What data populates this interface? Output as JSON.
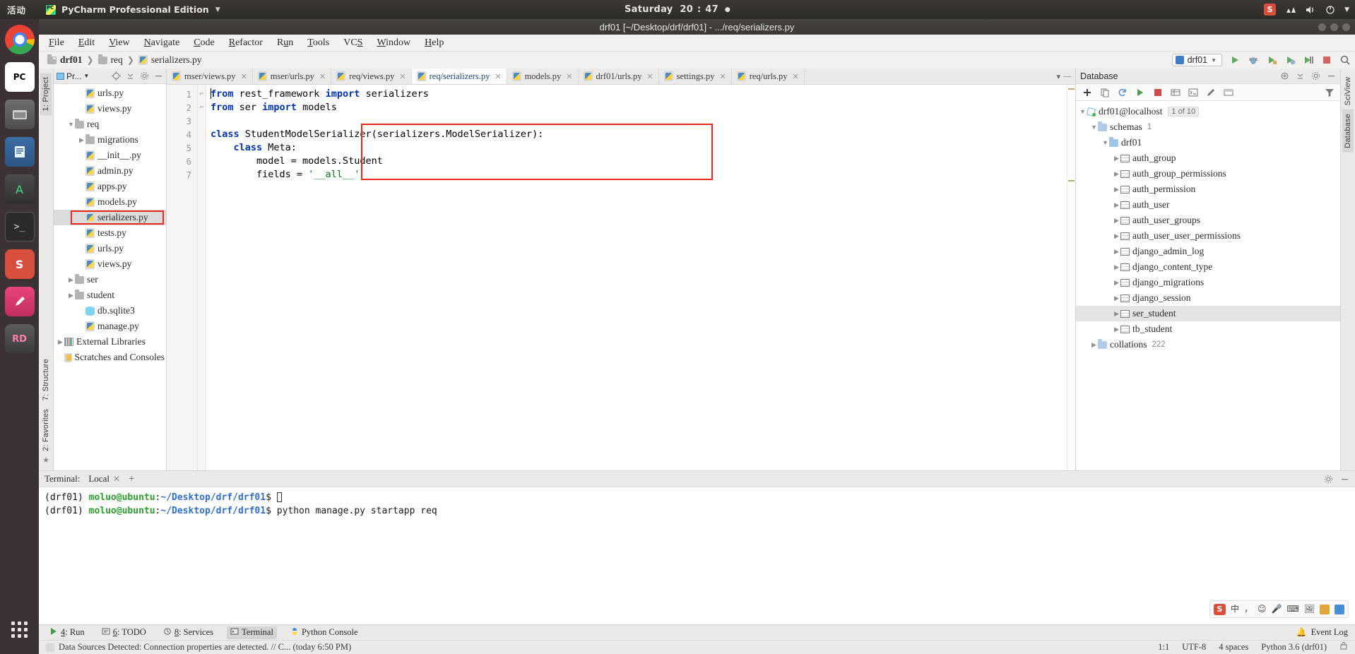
{
  "desktop": {
    "activities": "活动",
    "app_name": "PyCharm Professional Edition",
    "clock_day": "Saturday",
    "clock_hour": "20",
    "clock_sep": ":",
    "clock_min": "47",
    "tray": [
      "sogou-input-icon",
      "network-icon",
      "volume-icon",
      "power-icon",
      "caret-down-icon"
    ],
    "launcher": [
      {
        "name": "chrome",
        "label": ""
      },
      {
        "name": "pycharm",
        "label": "PC"
      },
      {
        "name": "files",
        "label": ""
      },
      {
        "name": "libreoffice",
        "label": ""
      },
      {
        "name": "android-studio",
        "label": "A"
      },
      {
        "name": "terminal",
        "label": ">_"
      },
      {
        "name": "sogou",
        "label": "S"
      },
      {
        "name": "pen-tool",
        "label": ""
      },
      {
        "name": "rd-tool",
        "label": "RD"
      }
    ]
  },
  "window": {
    "title": "drf01 [~/Desktop/drf/drf01] - .../req/serializers.py"
  },
  "menu": [
    {
      "pre": "",
      "mn": "F",
      "post": "ile"
    },
    {
      "pre": "",
      "mn": "E",
      "post": "dit"
    },
    {
      "pre": "",
      "mn": "V",
      "post": "iew"
    },
    {
      "pre": "",
      "mn": "N",
      "post": "avigate"
    },
    {
      "pre": "",
      "mn": "C",
      "post": "ode"
    },
    {
      "pre": "",
      "mn": "R",
      "post": "efactor"
    },
    {
      "pre": "R",
      "mn": "u",
      "post": "n"
    },
    {
      "pre": "",
      "mn": "T",
      "post": "ools"
    },
    {
      "pre": "VC",
      "mn": "S",
      "post": ""
    },
    {
      "pre": "",
      "mn": "W",
      "post": "indow"
    },
    {
      "pre": "",
      "mn": "H",
      "post": "elp"
    }
  ],
  "breadcrumb": {
    "items": [
      "drf01",
      "req",
      "serializers.py"
    ],
    "run_config": "drf01"
  },
  "project_panel": {
    "title": "Pr...",
    "tree": [
      {
        "label": "urls.py",
        "icon": "python-file-icon",
        "indent": 3,
        "arrow": "none",
        "selected": false
      },
      {
        "label": "views.py",
        "icon": "python-file-icon",
        "indent": 3,
        "arrow": "none",
        "selected": false
      },
      {
        "label": "req",
        "icon": "folder-icon",
        "indent": 2,
        "arrow": "expanded",
        "selected": false
      },
      {
        "label": "migrations",
        "icon": "folder-icon",
        "indent": 3,
        "arrow": "collapsed",
        "selected": false
      },
      {
        "label": "__init__.py",
        "icon": "python-file-icon",
        "indent": 3,
        "arrow": "none",
        "selected": false
      },
      {
        "label": "admin.py",
        "icon": "python-file-icon",
        "indent": 3,
        "arrow": "none",
        "selected": false
      },
      {
        "label": "apps.py",
        "icon": "python-file-icon",
        "indent": 3,
        "arrow": "none",
        "selected": false
      },
      {
        "label": "models.py",
        "icon": "python-file-icon",
        "indent": 3,
        "arrow": "none",
        "selected": false
      },
      {
        "label": "serializers.py",
        "icon": "python-file-icon",
        "indent": 3,
        "arrow": "none",
        "selected": true
      },
      {
        "label": "tests.py",
        "icon": "python-file-icon",
        "indent": 3,
        "arrow": "none",
        "selected": false
      },
      {
        "label": "urls.py",
        "icon": "python-file-icon",
        "indent": 3,
        "arrow": "none",
        "selected": false
      },
      {
        "label": "views.py",
        "icon": "python-file-icon",
        "indent": 3,
        "arrow": "none",
        "selected": false
      },
      {
        "label": "ser",
        "icon": "folder-icon",
        "indent": 2,
        "arrow": "collapsed",
        "selected": false
      },
      {
        "label": "student",
        "icon": "folder-icon",
        "indent": 2,
        "arrow": "collapsed",
        "selected": false
      },
      {
        "label": "db.sqlite3",
        "icon": "database-file-icon",
        "indent": 3,
        "arrow": "none",
        "selected": false
      },
      {
        "label": "manage.py",
        "icon": "python-file-icon",
        "indent": 3,
        "arrow": "none",
        "selected": false
      },
      {
        "label": "External Libraries",
        "icon": "library-icon",
        "indent": 1,
        "arrow": "collapsed",
        "selected": false
      },
      {
        "label": "Scratches and Consoles",
        "icon": "scratch-icon",
        "indent": 1,
        "arrow": "none",
        "selected": false
      }
    ]
  },
  "left_strip": [
    "1: Project",
    "7: Structure",
    "2: Favorites"
  ],
  "right_strip": [
    "SciView",
    "Database"
  ],
  "editor": {
    "tabs": [
      {
        "label": "mser/views.py",
        "active": false
      },
      {
        "label": "mser/urls.py",
        "active": false
      },
      {
        "label": "req/views.py",
        "active": false
      },
      {
        "label": "req/serializers.py",
        "active": true
      },
      {
        "label": "models.py",
        "active": false
      },
      {
        "label": "drf01/urls.py",
        "active": false
      },
      {
        "label": "settings.py",
        "active": false
      },
      {
        "label": "req/urls.py",
        "active": false
      }
    ],
    "line_numbers": [
      "1",
      "2",
      "3",
      "4",
      "5",
      "6",
      "7"
    ],
    "lines": [
      [
        {
          "t": "from ",
          "c": "kw"
        },
        {
          "t": "rest_framework ",
          "c": "pln"
        },
        {
          "t": "import ",
          "c": "kw"
        },
        {
          "t": "serializers",
          "c": "pln"
        }
      ],
      [
        {
          "t": "from ",
          "c": "kw"
        },
        {
          "t": "ser ",
          "c": "pln"
        },
        {
          "t": "import ",
          "c": "kw"
        },
        {
          "t": "models",
          "c": "pln"
        }
      ],
      [],
      [
        {
          "t": "class ",
          "c": "kw"
        },
        {
          "t": "StudentModelSerializer(serializers.ModelSerializer):",
          "c": "pln"
        }
      ],
      [
        {
          "t": "    class ",
          "c": "kw"
        },
        {
          "t": "Meta:",
          "c": "pln"
        }
      ],
      [
        {
          "t": "        model = models.Student",
          "c": "pln"
        }
      ],
      [
        {
          "t": "        fields = ",
          "c": "pln"
        },
        {
          "t": "'__all__'",
          "c": "str"
        }
      ]
    ]
  },
  "database": {
    "title": "Database",
    "tree": [
      {
        "label": "drf01@localhost",
        "icon": "connection-icon",
        "indent": 0,
        "arrow": "expanded",
        "badge": "",
        "chip": "1 of 10",
        "selected": false
      },
      {
        "label": "schemas",
        "icon": "folder-blue-icon",
        "indent": 1,
        "arrow": "expanded",
        "badge": "1",
        "chip": "",
        "selected": false
      },
      {
        "label": "drf01",
        "icon": "schema-icon",
        "indent": 2,
        "arrow": "expanded",
        "badge": "",
        "chip": "",
        "selected": false
      },
      {
        "label": "auth_group",
        "icon": "table-icon",
        "indent": 3,
        "arrow": "collapsed",
        "badge": "",
        "chip": "",
        "selected": false
      },
      {
        "label": "auth_group_permissions",
        "icon": "table-icon",
        "indent": 3,
        "arrow": "collapsed",
        "badge": "",
        "chip": "",
        "selected": false
      },
      {
        "label": "auth_permission",
        "icon": "table-icon",
        "indent": 3,
        "arrow": "collapsed",
        "badge": "",
        "chip": "",
        "selected": false
      },
      {
        "label": "auth_user",
        "icon": "table-icon",
        "indent": 3,
        "arrow": "collapsed",
        "badge": "",
        "chip": "",
        "selected": false
      },
      {
        "label": "auth_user_groups",
        "icon": "table-icon",
        "indent": 3,
        "arrow": "collapsed",
        "badge": "",
        "chip": "",
        "selected": false
      },
      {
        "label": "auth_user_user_permissions",
        "icon": "table-icon",
        "indent": 3,
        "arrow": "collapsed",
        "badge": "",
        "chip": "",
        "selected": false
      },
      {
        "label": "django_admin_log",
        "icon": "table-icon",
        "indent": 3,
        "arrow": "collapsed",
        "badge": "",
        "chip": "",
        "selected": false
      },
      {
        "label": "django_content_type",
        "icon": "table-icon",
        "indent": 3,
        "arrow": "collapsed",
        "badge": "",
        "chip": "",
        "selected": false
      },
      {
        "label": "django_migrations",
        "icon": "table-icon",
        "indent": 3,
        "arrow": "collapsed",
        "badge": "",
        "chip": "",
        "selected": false
      },
      {
        "label": "django_session",
        "icon": "table-icon",
        "indent": 3,
        "arrow": "collapsed",
        "badge": "",
        "chip": "",
        "selected": false
      },
      {
        "label": "ser_student",
        "icon": "table-icon",
        "indent": 3,
        "arrow": "collapsed",
        "badge": "",
        "chip": "",
        "selected": true
      },
      {
        "label": "tb_student",
        "icon": "table-icon",
        "indent": 3,
        "arrow": "collapsed",
        "badge": "",
        "chip": "",
        "selected": false
      },
      {
        "label": "collations",
        "icon": "folder-blue-icon",
        "indent": 1,
        "arrow": "collapsed",
        "badge": "222",
        "chip": "",
        "selected": false
      }
    ]
  },
  "terminal": {
    "label": "Terminal:",
    "tab": "Local",
    "lines": [
      {
        "venv": "(drf01)",
        "user": "moluo@ubuntu",
        "colon": ":",
        "path": "~/Desktop/drf/drf01",
        "cmd": "$ python manage.py startapp req"
      },
      {
        "venv": "(drf01)",
        "user": "moluo@ubuntu",
        "colon": ":",
        "path": "~/Desktop/drf/drf01",
        "cmd": "$ "
      }
    ],
    "ime": {
      "lang": "中",
      "items": [
        "sogou-icon",
        "lang-zh",
        "punct-icon",
        "emoji-icon",
        "mic-icon",
        "keyboard-icon",
        "image-icon",
        "toolbox-icon",
        "menu-icon"
      ]
    }
  },
  "bottom_bar": {
    "items": [
      {
        "pre": "",
        "mn": "4",
        "post": ": Run",
        "icon": "run-icon",
        "active": false
      },
      {
        "pre": "",
        "mn": "6",
        "post": ": TODO",
        "icon": "todo-icon",
        "active": false
      },
      {
        "pre": "",
        "mn": "8",
        "post": ": Services",
        "icon": "services-icon",
        "active": false
      },
      {
        "pre": "",
        "mn": "",
        "post": "Terminal",
        "icon": "terminal-icon",
        "active": true
      },
      {
        "pre": "",
        "mn": "",
        "post": "Python Console",
        "icon": "python-console-icon",
        "active": false
      }
    ],
    "event_log": "Event Log"
  },
  "status_bar": {
    "message": "Data Sources Detected: Connection properties are detected. // C... (today 6:50 PM)",
    "caret": "1:1",
    "encoding": "UTF-8",
    "indent": "4 spaces",
    "interpreter": "Python 3.6 (drf01)"
  }
}
